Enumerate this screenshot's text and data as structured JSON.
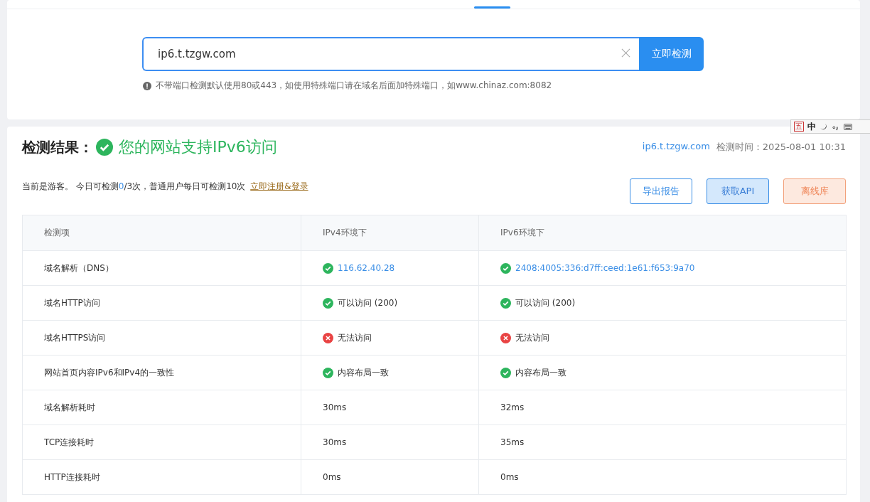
{
  "search": {
    "value": "ip6.t.tzgw.com",
    "button": "立即检测",
    "hint": "不带端口检测默认使用80或443，如使用特殊端口请在域名后面加特殊端口，如www.chinaz.com:8082"
  },
  "ime_toolbar": {
    "items": [
      "五",
      "中"
    ]
  },
  "result": {
    "heading": "检测结果：",
    "verdict": "您的网站支持IPv6访问",
    "verdict_ok": true,
    "domain": "ip6.t.tzgw.com",
    "time": "检测时间：2025-08-01 10:31",
    "quota": {
      "prefix": "当前是游客。 今日可检测",
      "used": "0",
      "rest": "/3次，普通用户每日可检测10次",
      "link": "立即注册&登录"
    },
    "buttons": [
      {
        "label": "导出报告",
        "kind": "outline"
      },
      {
        "label": "获取API",
        "kind": "soft"
      },
      {
        "label": "离线库",
        "kind": "warm"
      }
    ]
  },
  "table": {
    "columns": [
      "检测项",
      "IPv4环境下",
      "IPv6环境下"
    ],
    "rows": [
      {
        "cells": [
          {
            "kind": "plain",
            "text": "域名解析（DNS）",
            "link": false
          },
          {
            "kind": "ok",
            "text": "116.62.40.28",
            "link": true
          },
          {
            "kind": "ok",
            "text": "2408:4005:336:d7ff:ceed:1e61:f653:9a70",
            "link": true
          }
        ]
      },
      {
        "cells": [
          {
            "kind": "plain",
            "text": "域名HTTP访问",
            "link": false
          },
          {
            "kind": "ok",
            "text": "可以访问 (200)",
            "link": false
          },
          {
            "kind": "ok",
            "text": "可以访问 (200)",
            "link": false
          }
        ]
      },
      {
        "cells": [
          {
            "kind": "plain",
            "text": "域名HTTPS访问",
            "link": false
          },
          {
            "kind": "fail",
            "text": "无法访问",
            "link": false
          },
          {
            "kind": "fail",
            "text": "无法访问",
            "link": false
          }
        ]
      },
      {
        "cells": [
          {
            "kind": "plain",
            "text": "网站首页内容IPv6和IPv4的一致性",
            "link": false
          },
          {
            "kind": "ok",
            "text": "内容布局一致",
            "link": false
          },
          {
            "kind": "ok",
            "text": "内容布局一致",
            "link": false
          }
        ]
      },
      {
        "cells": [
          {
            "kind": "plain",
            "text": "域名解析耗时",
            "link": false
          },
          {
            "kind": "plain",
            "text": "30ms",
            "link": false
          },
          {
            "kind": "plain",
            "text": "32ms",
            "link": false
          }
        ]
      },
      {
        "cells": [
          {
            "kind": "plain",
            "text": "TCP连接耗时",
            "link": false
          },
          {
            "kind": "plain",
            "text": "30ms",
            "link": false
          },
          {
            "kind": "plain",
            "text": "35ms",
            "link": false
          }
        ]
      },
      {
        "cells": [
          {
            "kind": "plain",
            "text": "HTTP连接耗时",
            "link": false
          },
          {
            "kind": "plain",
            "text": "0ms",
            "link": false
          },
          {
            "kind": "plain",
            "text": "0ms",
            "link": false
          }
        ]
      }
    ]
  }
}
